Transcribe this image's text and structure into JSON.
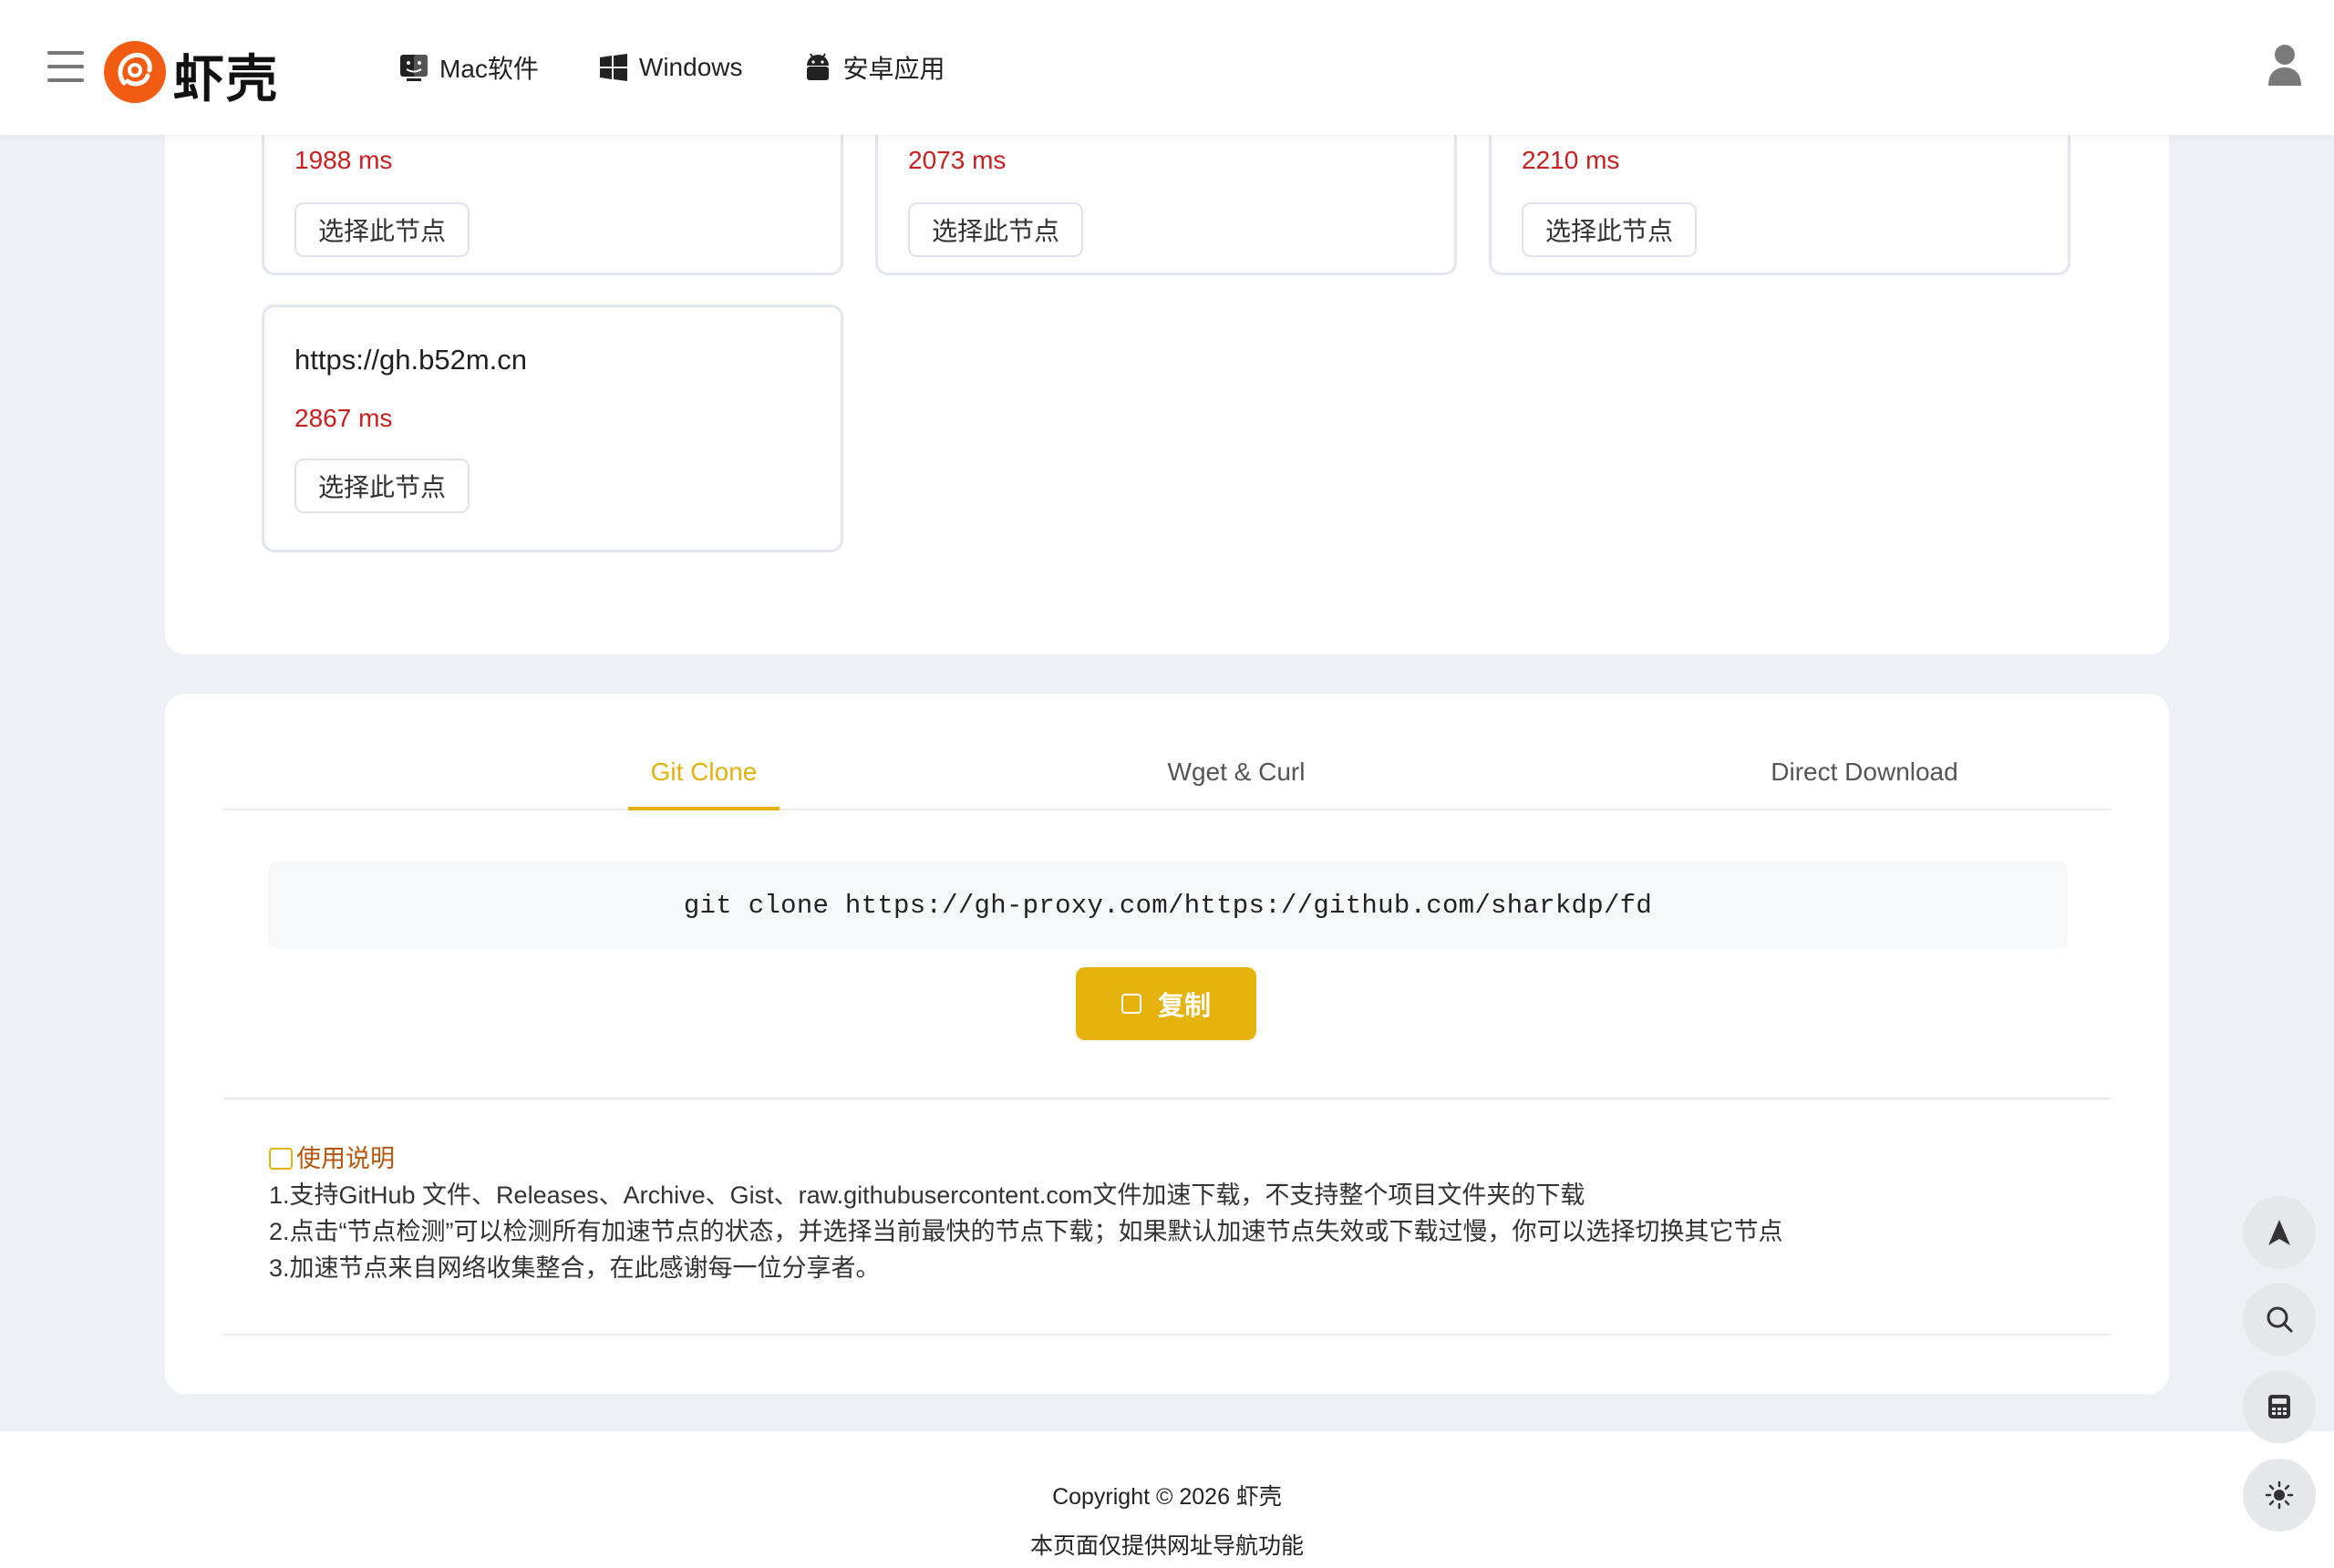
{
  "header": {
    "logo_text": "虾壳",
    "nav": [
      {
        "label": "Mac软件",
        "icon": "mac-finder-icon"
      },
      {
        "label": "Windows",
        "icon": "windows-icon"
      },
      {
        "label": "安卓应用",
        "icon": "android-icon"
      }
    ],
    "menu_icon": "hamburger-menu-icon",
    "user_icon": "user-icon"
  },
  "nodes": [
    {
      "latency": "1988 ms",
      "button": "选择此节点"
    },
    {
      "latency": "2073 ms",
      "button": "选择此节点"
    },
    {
      "latency": "2210 ms",
      "button": "选择此节点"
    },
    {
      "url": "https://gh.b52m.cn",
      "latency": "2867 ms",
      "button": "选择此节点"
    }
  ],
  "tabs": [
    {
      "label": "Git Clone",
      "active": true
    },
    {
      "label": "Wget & Curl",
      "active": false
    },
    {
      "label": "Direct Download",
      "active": false
    }
  ],
  "command": "git clone https://gh-proxy.com/https://github.com/sharkdp/fd",
  "copy_button": "复制",
  "usage": {
    "title": "使用说明",
    "lines": [
      "1.支持GitHub 文件、Releases、Archive、Gist、raw.githubusercontent.com文件加速下载，不支持整个项目文件夹的下载",
      "2.点击“节点检测”可以检测所有加速节点的状态，并选择当前最快的节点下载；如果默认加速节点失效或下载过慢，你可以选择切换其它节点",
      "3.加速节点来自网络收集整合，在此感谢每一位分享者。"
    ]
  },
  "footer": {
    "copyright": "Copyright © 2026 虾壳",
    "note": "本页面仅提供网址导航功能"
  },
  "floating_buttons": [
    "back-to-top-icon",
    "search-icon",
    "calculator-icon",
    "theme-sun-icon"
  ],
  "colors": {
    "accent": "#e6b20e",
    "latency": "#c8201e",
    "logo": "#f25c12",
    "page_bg": "#edf1f6"
  }
}
